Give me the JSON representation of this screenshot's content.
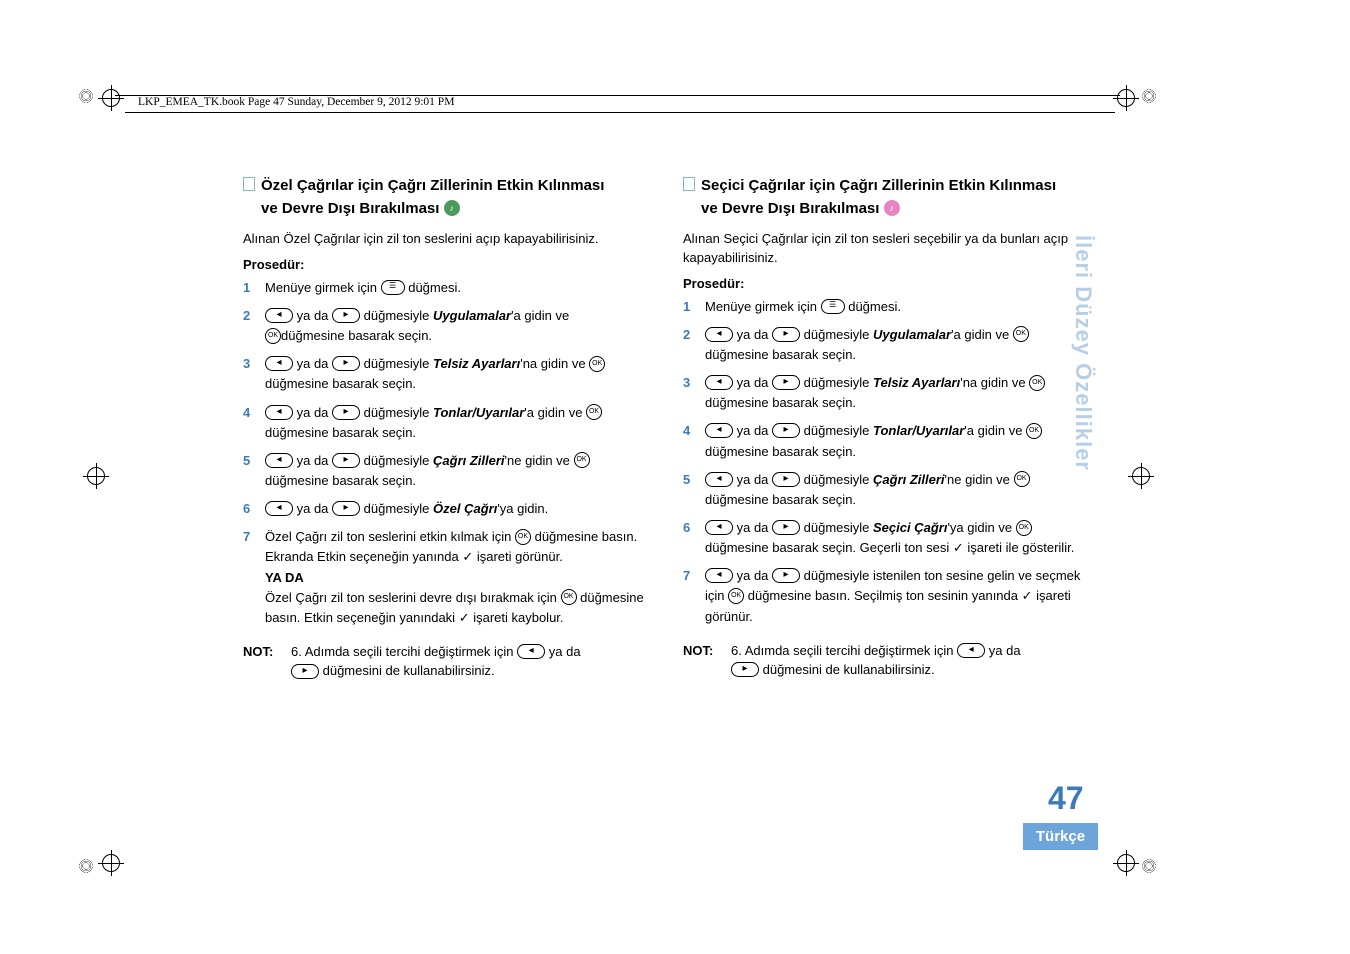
{
  "header": "LKP_EMEA_TK.book  Page 47  Sunday, December 9, 2012  9:01 PM",
  "sidebar": "İleri Düzey Özellikler",
  "pageNumber": "47",
  "language": "Türkçe",
  "left": {
    "title_l1": "Özel Çağrılar için Çağrı Zillerinin Etkin Kılınması",
    "title_l2": "ve Devre Dışı Bırakılması",
    "intro": "Alınan Özel Çağrılar için zil ton seslerini açıp kapayabilirisiniz.",
    "procLabel": "Prosedür:",
    "s1_a": "Menüye girmek için ",
    "s1_b": " düğmesi.",
    "s2_a": " ya da ",
    "s2_b": " düğmesiyle ",
    "s2_c": "Uygulamalar",
    "s2_d": "'a gidin ve ",
    "s2_e": "düğmesine basarak seçin.",
    "s3_a": " ya da ",
    "s3_b": " düğmesiyle ",
    "s3_c": "Telsiz Ayarları",
    "s3_d": "'na gidin ve ",
    "s3_e": "düğmesine basarak seçin.",
    "s4_a": " ya da ",
    "s4_b": " düğmesiyle ",
    "s4_c": "Tonlar/Uyarılar",
    "s4_d": "'a gidin ve ",
    "s4_e": "düğmesine basarak seçin.",
    "s5_a": " ya da ",
    "s5_b": " düğmesiyle ",
    "s5_c": "Çağrı Zilleri",
    "s5_d": "'ne gidin ve ",
    "s5_e": "düğmesine basarak seçin.",
    "s6_a": " ya da ",
    "s6_b": " düğmesiyle ",
    "s6_c": "Özel Çağrı",
    "s6_d": "'ya gidin.",
    "s7_a": "Özel Çağrı zil ton seslerini etkin kılmak için ",
    "s7_b": " düğmesine basın. Ekranda Etkin seçeneğin yanında ",
    "s7_c": " işareti görünür.",
    "yada": "YA DA",
    "s7_d": "Özel Çağrı zil ton seslerini devre dışı bırakmak için ",
    "s7_e": " düğmesine basın. Etkin seçeneğin yanındaki ",
    "s7_f": " işareti kaybolur.",
    "noteLabel": "NOT:",
    "note_a": "6. Adımda seçili tercihi değiştirmek için ",
    "note_b": " ya da ",
    "note_c": " düğmesini de kullanabilirsiniz."
  },
  "right": {
    "title_l1": "Seçici Çağrılar için Çağrı Zillerinin Etkin Kılınması",
    "title_l2": "ve Devre Dışı Bırakılması",
    "intro": "Alınan Seçici Çağrılar için zil ton sesleri seçebilir ya da bunları açıp kapayabilirisiniz.",
    "procLabel": "Prosedür:",
    "s1_a": "Menüye girmek için ",
    "s1_b": " düğmesi.",
    "s2_a": " ya da ",
    "s2_b": " düğmesiyle ",
    "s2_c": "Uygulamalar",
    "s2_d": "'a gidin ve ",
    "s2_e": "düğmesine basarak seçin.",
    "s3_a": " ya da ",
    "s3_b": " düğmesiyle ",
    "s3_c": "Telsiz Ayarları",
    "s3_d": "'na gidin ve ",
    "s3_e": "düğmesine basarak seçin.",
    "s4_a": " ya da ",
    "s4_b": " düğmesiyle ",
    "s4_c": "Tonlar/Uyarılar",
    "s4_d": "'a gidin ve ",
    "s4_e": "düğmesine basarak seçin.",
    "s5_a": " ya da ",
    "s5_b": " düğmesiyle ",
    "s5_c": "Çağrı Zilleri",
    "s5_d": "'ne gidin ve ",
    "s5_e": "düğmesine basarak seçin.",
    "s6_a": " ya da ",
    "s6_b": " düğmesiyle ",
    "s6_c": "Seçici Çağrı",
    "s6_d": "'ya gidin ve ",
    "s6_e": "düğmesine basarak seçin. Geçerli ton sesi ",
    "s6_f": " işareti ile gösterilir.",
    "s7_a": " ya da ",
    "s7_b": " düğmesiyle istenilen ton sesine gelin ve seçmek için ",
    "s7_c": " düğmesine basın. Seçilmiş ton sesinin yanında ",
    "s7_d": " işareti görünür.",
    "noteLabel": "NOT:",
    "note_a": "6. Adımda seçili tercihi değiştirmek için ",
    "note_b": " ya da ",
    "note_c": " düğmesini de kullanabilirsiniz."
  },
  "nums": {
    "n1": "1",
    "n2": "2",
    "n3": "3",
    "n4": "4",
    "n5": "5",
    "n6": "6",
    "n7": "7"
  },
  "check": "✓"
}
